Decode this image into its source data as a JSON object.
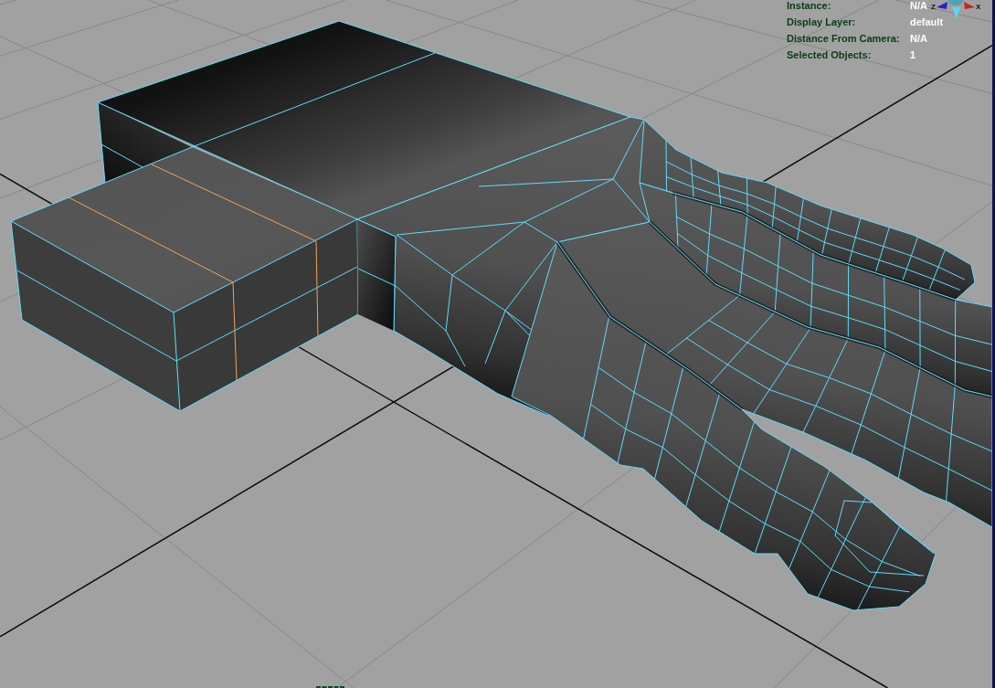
{
  "viewport": {
    "hud": [
      {
        "label": "Instance:",
        "value": "N/A"
      },
      {
        "label": "Display Layer:",
        "value": "default"
      },
      {
        "label": "Distance From Camera:",
        "value": "N/A"
      },
      {
        "label": "Selected Objects:",
        "value": "1"
      }
    ],
    "view_axis": [
      {
        "label": "Z",
        "color": "#2424c8"
      },
      {
        "label": "X",
        "color": "#c82424"
      }
    ]
  }
}
